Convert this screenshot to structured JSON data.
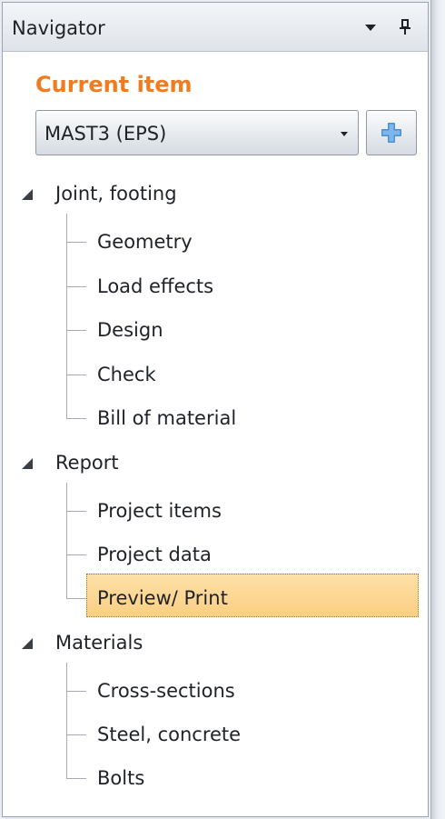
{
  "navigator": {
    "title": "Navigator",
    "current_item_label": "Current item",
    "combo_value": "MAST3 (EPS)",
    "groups": [
      {
        "label": "Joint, footing",
        "items": [
          "Geometry",
          "Load effects",
          "Design",
          "Check",
          "Bill of material"
        ]
      },
      {
        "label": "Report",
        "items": [
          "Project items",
          "Project data",
          "Preview/ Print"
        ]
      },
      {
        "label": "Materials",
        "items": [
          "Cross-sections",
          "Steel, concrete",
          "Bolts"
        ]
      }
    ],
    "selected_item": "Preview/ Print"
  },
  "icons": {
    "dropdown": "chevron-down-icon",
    "pin": "pin-icon",
    "add": "plus-icon",
    "expanded": "expanded-triangle-icon"
  },
  "colors": {
    "accent": "#f07c22",
    "selection": "#fcd48a",
    "plus": "#4a90d9"
  }
}
